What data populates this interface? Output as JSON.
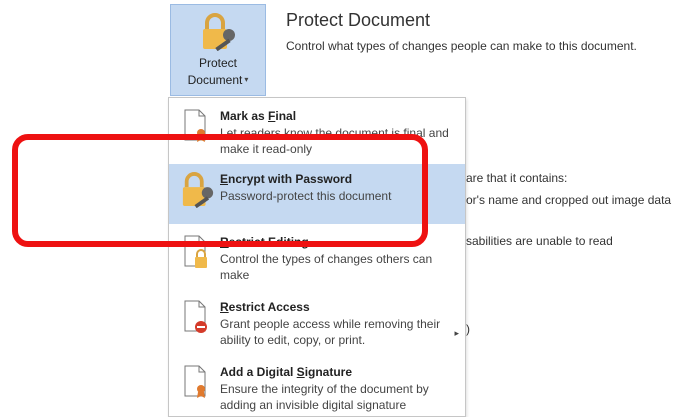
{
  "protect_button": {
    "line1": "Protect",
    "line2": "Document",
    "caret": "▾"
  },
  "header": {
    "title": "Protect Document",
    "description": "Control what types of changes people can make to this document."
  },
  "background": {
    "line1": "are that it contains:",
    "line2": "or's name and cropped out image data",
    "line3": "sabilities are unable to read",
    "line4": ")"
  },
  "menu": {
    "items": [
      {
        "title_pre": "Mark as ",
        "title_key": "F",
        "title_post": "inal",
        "desc": "Let readers know the document is final and make it read-only",
        "icon": "mark-final-icon"
      },
      {
        "title_pre": "",
        "title_key": "E",
        "title_post": "ncrypt with Password",
        "desc": "Password-protect this document",
        "icon": "lock-key-icon"
      },
      {
        "title_pre": "",
        "title_key": "R",
        "title_post": "estrict Editing",
        "desc": "Control the types of changes others can make",
        "icon": "restrict-editing-icon"
      },
      {
        "title_pre": "",
        "title_key": "R",
        "title_post": "estrict Access",
        "desc": "Grant people access while removing their ability to edit, copy, or print.",
        "icon": "restrict-access-icon",
        "submenu": "▸"
      },
      {
        "title_pre": "Add a Digital ",
        "title_key": "S",
        "title_post": "ignature",
        "desc": "Ensure the integrity of the document by adding an invisible digital signature",
        "icon": "digital-signature-icon"
      }
    ]
  },
  "colors": {
    "highlight": "#c5d9f1",
    "annotation_red": "#ee1111"
  }
}
